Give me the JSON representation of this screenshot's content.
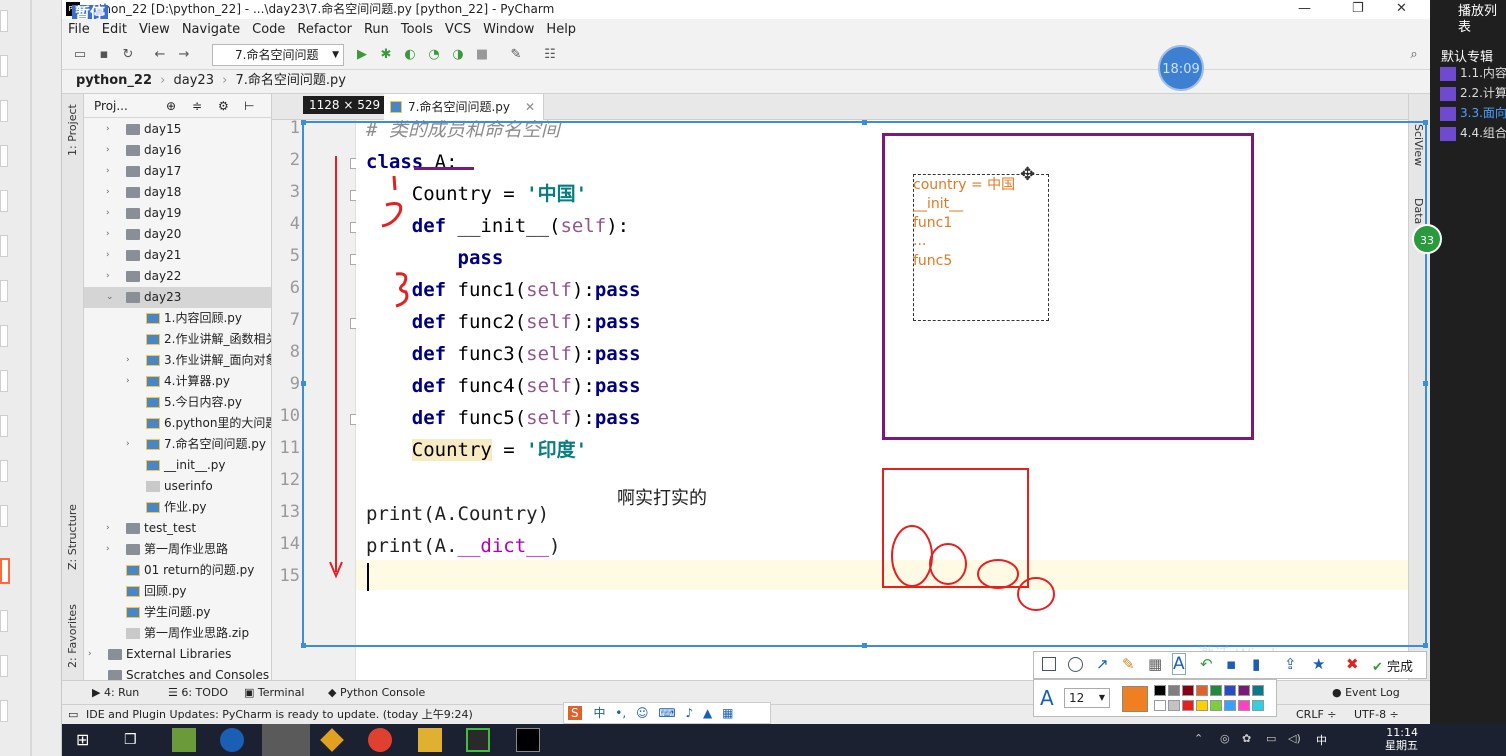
{
  "window": {
    "title": "python_22 [D:\\python_22] - ...\\day23\\7.命名空间问题.py [python_22] - PyCharm",
    "pause_label": "暂停"
  },
  "menu": [
    "File",
    "Edit",
    "View",
    "Navigate",
    "Code",
    "Refactor",
    "Run",
    "Tools",
    "VCS",
    "Window",
    "Help"
  ],
  "toolbar": {
    "run_config": "7.命名空间问题",
    "clock": "18:09"
  },
  "breadcrumb": [
    "python_22",
    "day23",
    "7.命名空间问题.py"
  ],
  "project_panel": {
    "title": "Proj...",
    "tree": [
      {
        "label": "day15",
        "type": "folder",
        "level": 1,
        "chevron": "›"
      },
      {
        "label": "day16",
        "type": "folder",
        "level": 1,
        "chevron": "›"
      },
      {
        "label": "day17",
        "type": "folder",
        "level": 1,
        "chevron": "›"
      },
      {
        "label": "day18",
        "type": "folder",
        "level": 1,
        "chevron": "›"
      },
      {
        "label": "day19",
        "type": "folder",
        "level": 1,
        "chevron": "›"
      },
      {
        "label": "day20",
        "type": "folder",
        "level": 1,
        "chevron": "›"
      },
      {
        "label": "day21",
        "type": "folder",
        "level": 1,
        "chevron": "›"
      },
      {
        "label": "day22",
        "type": "folder",
        "level": 1,
        "chevron": "›"
      },
      {
        "label": "day23",
        "type": "folder",
        "level": 1,
        "chevron": "⌄"
      },
      {
        "label": "1.内容回顾.py",
        "type": "py",
        "level": 2,
        "chevron": ""
      },
      {
        "label": "2.作业讲解_函数相关",
        "type": "py",
        "level": 2,
        "chevron": ""
      },
      {
        "label": "3.作业讲解_面向对象",
        "type": "py",
        "level": 2,
        "chevron": "›"
      },
      {
        "label": "4.计算器.py",
        "type": "py",
        "level": 2,
        "chevron": "›"
      },
      {
        "label": "5.今日内容.py",
        "type": "py",
        "level": 2,
        "chevron": ""
      },
      {
        "label": "6.python里的大问题",
        "type": "py",
        "level": 2,
        "chevron": ""
      },
      {
        "label": "7.命名空间问题.py",
        "type": "py",
        "level": 2,
        "chevron": "›"
      },
      {
        "label": "__init__.py",
        "type": "py",
        "level": 2,
        "chevron": ""
      },
      {
        "label": "userinfo",
        "type": "file",
        "level": 2,
        "chevron": ""
      },
      {
        "label": "作业.py",
        "type": "py",
        "level": 2,
        "chevron": ""
      },
      {
        "label": "test_test",
        "type": "folder",
        "level": 1,
        "chevron": "›"
      },
      {
        "label": "第一周作业思路",
        "type": "folder",
        "level": 1,
        "chevron": "›"
      },
      {
        "label": "01 return的问题.py",
        "type": "py",
        "level": 1,
        "chevron": ""
      },
      {
        "label": "回顾.py",
        "type": "py",
        "level": 1,
        "chevron": ""
      },
      {
        "label": "学生问题.py",
        "type": "py",
        "level": 1,
        "chevron": ""
      },
      {
        "label": "第一周作业思路.zip",
        "type": "file",
        "level": 1,
        "chevron": ""
      },
      {
        "label": "External Libraries",
        "type": "lib",
        "level": 0,
        "chevron": "›"
      },
      {
        "label": "Scratches and Consoles",
        "type": "lib",
        "level": 0,
        "chevron": ""
      }
    ]
  },
  "editor": {
    "tab_label": "7.命名空间问题.py",
    "size_badge": "1128 × 529",
    "line_numbers": [
      "1",
      "2",
      "3",
      "4",
      "5",
      "6",
      "7",
      "8",
      "9",
      "10",
      "11",
      "12",
      "13",
      "14",
      "15"
    ],
    "lines": {
      "l1": "# 类的成员和命名空间",
      "l2_kw": "class",
      "l2_rest": " A:",
      "l3_a": "    Country = ",
      "l3_b": "'中国'",
      "l4_kw": "    def",
      "l4_a": " __init__(",
      "l4_self": "self",
      "l4_b": "):",
      "l5": "        pass",
      "f_kw": "def",
      "f_self": "self",
      "f_pass": "pass",
      "f1": " func1(",
      "f2": " func2(",
      "f3": " func3(",
      "f4": " func4(",
      "f5": " func5(",
      "l11_a": "Country",
      "l11_b": " = ",
      "l11_c": "'印度'",
      "l13": "print(A.Country)",
      "l14_a": "print(A.",
      "l14_b": "__dict__",
      "l14_c": ")"
    }
  },
  "annotations": {
    "namespace_lines": [
      "country = 中国",
      "__init__",
      "func1",
      "...",
      "func5"
    ],
    "chinese_note": "啊实打实的"
  },
  "tool_strip": {
    "project": "1: Project",
    "structure": "Z: Structure",
    "favorites": "2: Favorites",
    "sciview": "SciView",
    "data": "Data"
  },
  "bottom_tabs": [
    "4: Run",
    "6: TODO",
    "Terminal",
    "Python Console",
    "Event Log"
  ],
  "status": {
    "message": "IDE and Plugin Updates: PyCharm is ready to update. (today 上午9:24)",
    "crlf": "CRLF ÷",
    "encoding": "UTF-8 ÷"
  },
  "playlist": {
    "title": "播放列表",
    "album": "默认专辑",
    "items": [
      "1.1.内容",
      "2.2.计算",
      "3.3.面向",
      "4.4.组合"
    ],
    "badge": "33"
  },
  "snip_tool": {
    "done_label": "完成",
    "font_size": "12"
  },
  "watermark": {
    "line1": "激活 Windows",
    "line2": "转到\"设置\"以激活 Windows。"
  },
  "taskbar": {
    "time": "11:14",
    "day": "星期五",
    "ime": "中"
  },
  "colors": {
    "accent_purple": "#7a1a78",
    "annotation_red": "#e52020",
    "selection_blue": "#3b8ed8"
  }
}
